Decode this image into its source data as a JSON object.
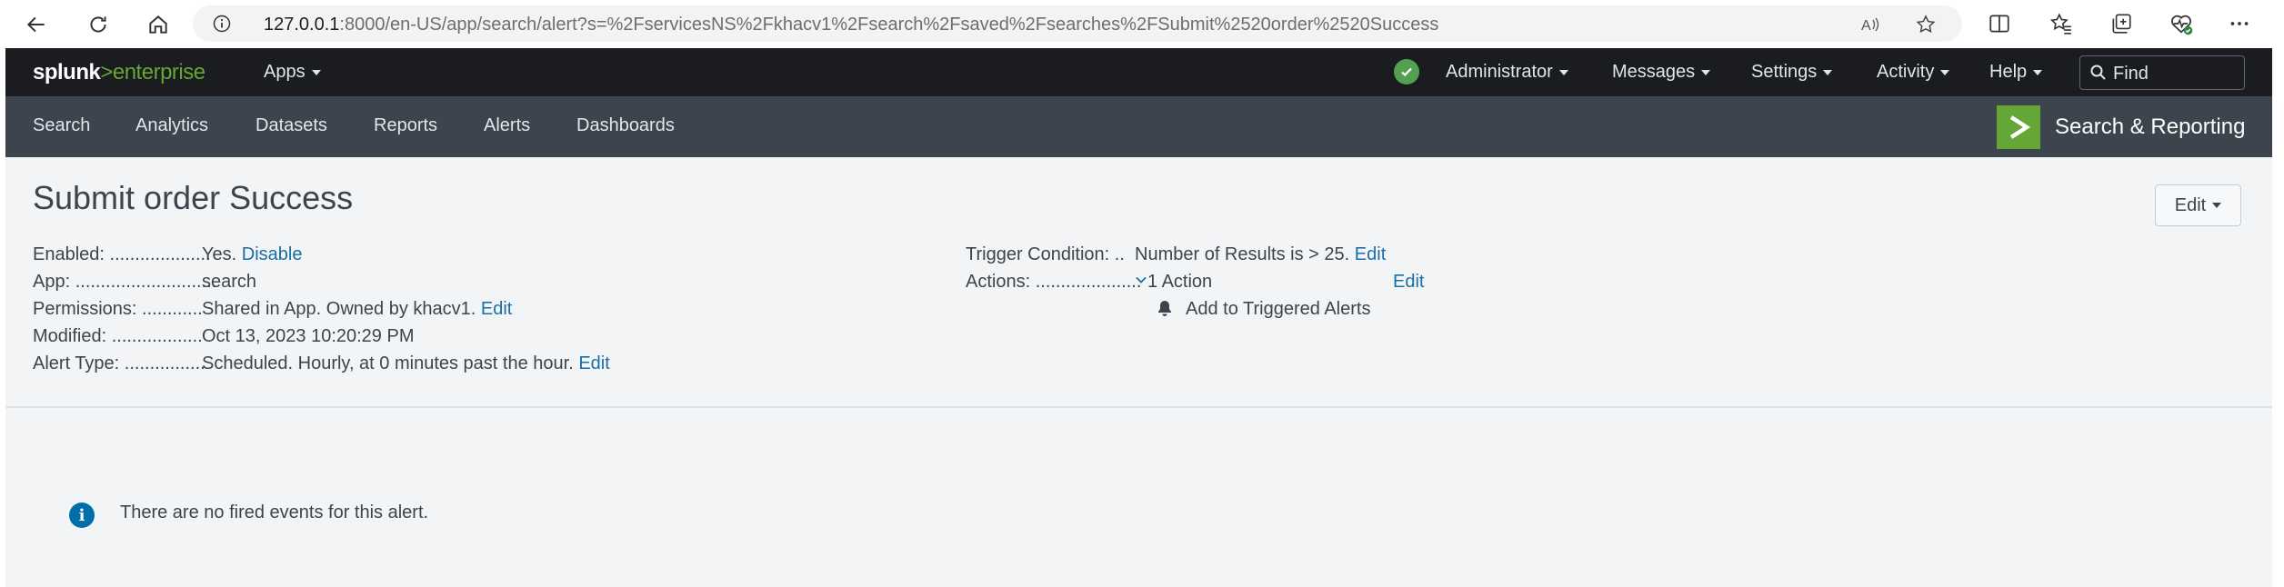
{
  "browser": {
    "url_host": "127.0.0.1",
    "url_rest": ":8000/en-US/app/search/alert?s=%2FservicesNS%2Fkhacv1%2Fsearch%2Fsaved%2Fsearches%2FSubmit%2520order%2520Success",
    "icons": [
      "back-icon",
      "reload-icon",
      "home-icon",
      "info-icon",
      "read-aloud-icon",
      "favorite-star-icon",
      "split-screen-icon",
      "favorites-icon",
      "collections-icon",
      "browser-essentials-icon",
      "more-icon"
    ]
  },
  "topbar": {
    "logo_splunk": "splunk",
    "logo_gt": ">",
    "logo_enterprise": "enterprise",
    "apps": "Apps",
    "administrator": "Administrator",
    "messages": "Messages",
    "settings": "Settings",
    "activity": "Activity",
    "help": "Help",
    "find_placeholder": "Find"
  },
  "appbar": {
    "tabs": [
      "Search",
      "Analytics",
      "Datasets",
      "Reports",
      "Alerts",
      "Dashboards"
    ],
    "app_name": "Search & Reporting"
  },
  "alert": {
    "title": "Submit order Success",
    "edit_button": "Edit",
    "enabled_label": "Enabled: ....................",
    "enabled_value": "Yes.",
    "enabled_link": "Disable",
    "app_label": "App: ............................",
    "app_value": "search",
    "permissions_label": "Permissions: ............",
    "permissions_value": "Shared in App. Owned by khacv1.",
    "permissions_link": "Edit",
    "modified_label": "Modified: ..................",
    "modified_value": "Oct 13, 2023 10:20:29 PM",
    "alert_type_label": "Alert Type: ................",
    "alert_type_value": "Scheduled. Hourly, at 0 minutes past the hour.",
    "alert_type_link": "Edit",
    "trigger_label": "Trigger Condition: ..",
    "trigger_value": "Number of Results is > 25.",
    "trigger_link": "Edit",
    "actions_label": "Actions: .....................",
    "actions_value": "1 Action",
    "actions_link": "Edit",
    "action_item": "Add to Triggered Alerts"
  },
  "events": {
    "message": "There are no fired events for this alert."
  },
  "colors": {
    "topbar": "#1a1c20",
    "appbar": "#3c444d",
    "accent_green": "#65a637",
    "link_blue": "#1a6ea8",
    "info_blue": "#006eaa"
  }
}
